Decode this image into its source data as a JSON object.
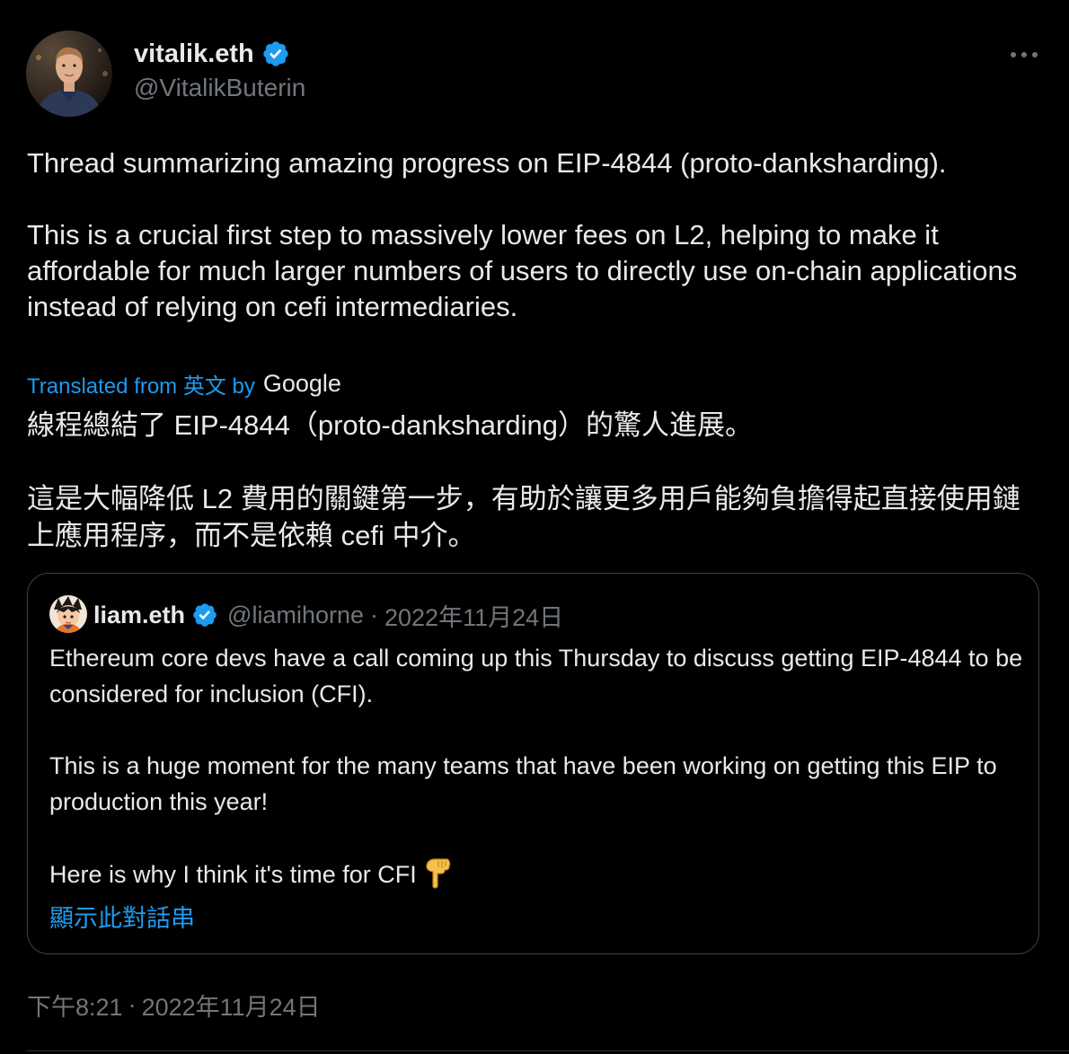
{
  "author": {
    "display_name": "vitalik.eth",
    "handle": "@VitalikButerin",
    "avatar_icon": "profile-photo",
    "verified_icon": "verified-badge-icon"
  },
  "more_icon": "more-options-icon",
  "tweet": {
    "text": "Thread summarizing amazing progress on EIP-4844 (proto-danksharding).\n\nThis is a crucial first step to massively lower fees on L2, helping to make it affordable for much larger numbers of users to directly use on-chain applications instead of relying on cefi intermediaries.",
    "translated_label": "Translated from 英文 by",
    "translator_brand": "Google",
    "translation": "線程總結了 EIP-4844（proto-danksharding）的驚人進展。\n\n這是大幅降低 L2 費用的關鍵第一步，有助於讓更多用戶能夠負擔得起直接使用鏈上應用程序，而不是依賴 cefi 中介。",
    "time": "下午8:21",
    "separator": "·",
    "date": "2022年11月24日"
  },
  "quote": {
    "display_name": "liam.eth",
    "handle": "@liamihorne",
    "separator": "·",
    "date": "2022年11月24日",
    "text": "Ethereum core devs have a call coming up this Thursday to discuss getting EIP-4844 to be considered for inclusion (CFI).\n\nThis is a huge moment for the many teams that have been working on getting this EIP to production this year!\n\nHere is why I think it's time for CFI",
    "emoji_icon": "pointing-down-hand-emoji",
    "show_thread_label": "顯示此對話串"
  },
  "colors": {
    "background": "#000000",
    "text_primary": "#e7e9ea",
    "text_secondary": "#71767b",
    "link": "#1d9bf0",
    "verified": "#1d9bf0",
    "border": "#3e4144"
  }
}
